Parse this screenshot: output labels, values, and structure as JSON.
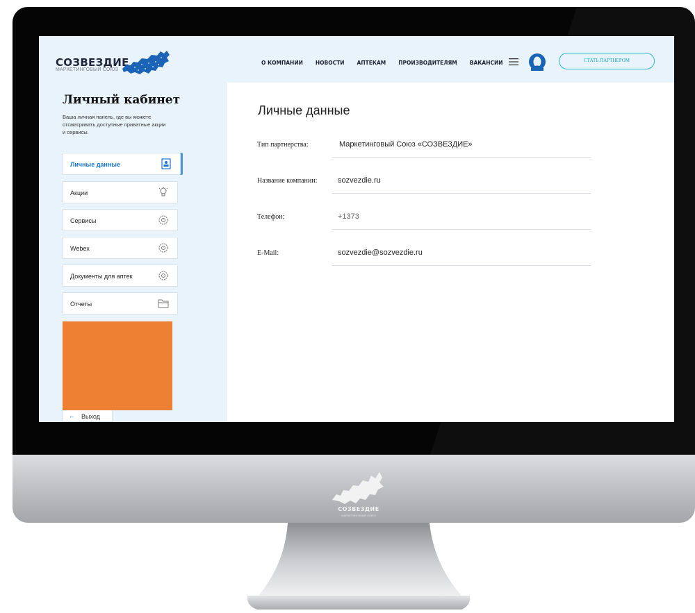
{
  "header": {
    "logo_text": "СОЗВЕЗДИЕ",
    "logo_sub": "МАРКЕТИНГОВЫЙ СОЮЗ",
    "nav": [
      "О КОМПАНИИ",
      "НОВОСТИ",
      "АПТЕКАМ",
      "ПРОИЗВОДИТЕЛЯМ",
      "ВАКАНСИИ"
    ],
    "partner_button": "СТАТЬ ПАРТНЕРОМ",
    "menu_icon": "hamburger-icon",
    "user_icon": "user-avatar-icon"
  },
  "sidebar": {
    "title": "Личный кабинет",
    "description": "Ваша личная панель, где вы можете отсматривать доступные приватные акции и сервисы.",
    "items": [
      {
        "label": "Личные данные",
        "icon": "id-card-icon",
        "active": true
      },
      {
        "label": "Акции",
        "icon": "lightbulb-icon",
        "active": false
      },
      {
        "label": "Сервисы",
        "icon": "gear-icon",
        "active": false
      },
      {
        "label": "Webex",
        "icon": "gear-icon",
        "active": false
      },
      {
        "label": "Документы для аптек",
        "icon": "gear-icon",
        "active": false
      },
      {
        "label": "Отчеты",
        "icon": "folder-icon",
        "active": false
      }
    ],
    "logout": "Выход"
  },
  "main": {
    "title": "Личные данные",
    "fields": [
      {
        "label": "Тип партнерства:",
        "value": "Маркетинговый Союз «СОЗВЕЗДИЕ»"
      },
      {
        "label": "Название компании:",
        "value": "sozvezdie.ru"
      },
      {
        "label": "Телефон:",
        "value": "+1373"
      },
      {
        "label": "E-Mail:",
        "value": "sozvezdie@sozvezdie.ru"
      }
    ]
  },
  "monitor": {
    "chin_brand": "СОЗВЕЗДИЕ",
    "chin_sub": "МАРКЕТИНГОВЫЙ СОЮЗ"
  },
  "colors": {
    "accent": "#1976d2",
    "panel_bg": "#e9f3fb",
    "banner": "#ee8033",
    "partner_border": "#23b8c8"
  }
}
